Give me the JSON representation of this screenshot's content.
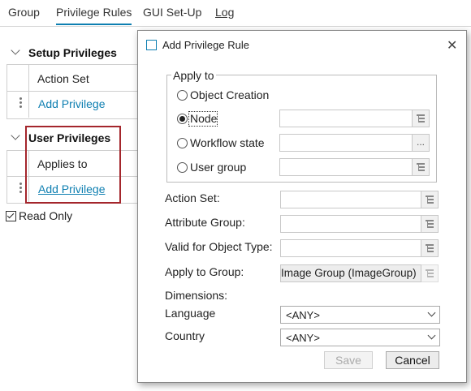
{
  "tabs": [
    {
      "label": "Group"
    },
    {
      "label": "Privilege Rules"
    },
    {
      "label": "GUI Set-Up"
    },
    {
      "label": "Log"
    }
  ],
  "setup_privileges": {
    "title": "Setup Privileges",
    "column_header": "Action Set",
    "add_link": "Add Privilege"
  },
  "user_privileges": {
    "title": "User Privileges",
    "column_header": "Applies to",
    "add_link": "Add Privilege"
  },
  "read_only": {
    "label": "Read Only",
    "checked": true
  },
  "dialog": {
    "title": "Add Privilege Rule",
    "apply_to": {
      "legend": "Apply to",
      "options": [
        {
          "label": "Object Creation",
          "selected": false
        },
        {
          "label": "Node",
          "selected": true
        },
        {
          "label": "Workflow state",
          "selected": false
        },
        {
          "label": "User group",
          "selected": false
        }
      ]
    },
    "fields": {
      "action_set": {
        "label": "Action Set:",
        "value": ""
      },
      "attribute_group": {
        "label": "Attribute Group:",
        "value": ""
      },
      "valid_for_object_type": {
        "label": "Valid for Object Type:",
        "value": ""
      },
      "apply_to_group": {
        "label": "Apply to Group:",
        "value": "Image Group (ImageGroup)"
      }
    },
    "dimensions": {
      "label": "Dimensions:",
      "language": {
        "label": "Language",
        "value": "<ANY>"
      },
      "country": {
        "label": "Country",
        "value": "<ANY>"
      }
    },
    "buttons": {
      "save": "Save",
      "cancel": "Cancel"
    },
    "ellipsis": "..."
  },
  "colors": {
    "accent": "#0e7fb1",
    "highlight_box": "#a4262c"
  }
}
